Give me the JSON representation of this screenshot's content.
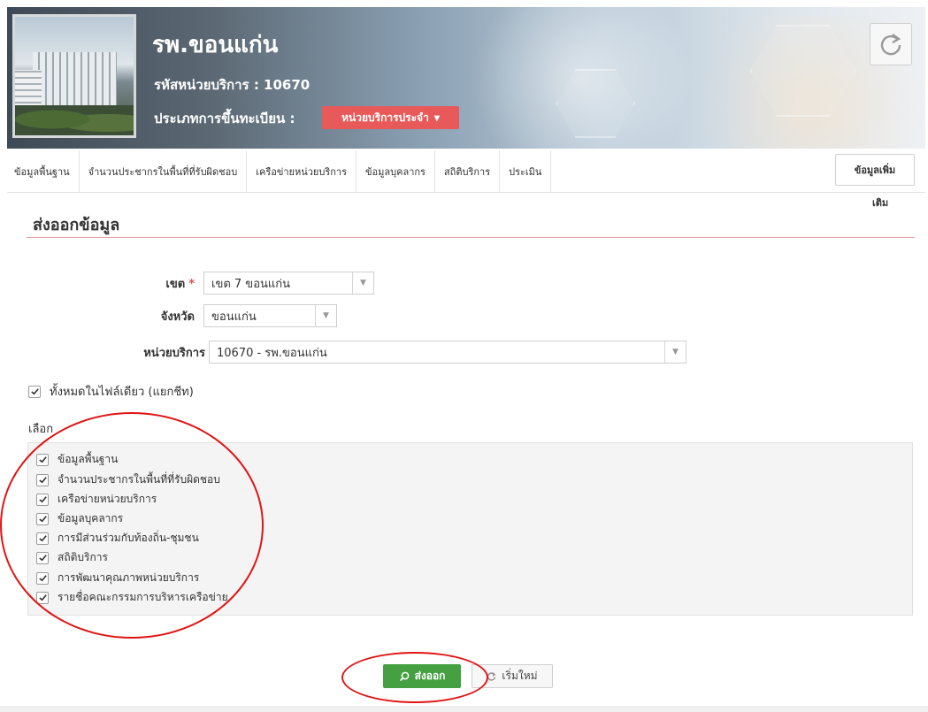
{
  "header": {
    "hospital_name": "รพ.ขอนแก่น",
    "unit_code": "รหัสหน่วยบริการ : 10670",
    "type_label": "ประเภทการขึ้นทะเบียน :",
    "type_value": "หน่วยบริการประจำ",
    "refresh_icon": "refresh-icon"
  },
  "nav": {
    "tabs": [
      "ข้อมูลพื้นฐาน",
      "จำนวนประชากรในพื้นที่ที่รับผิดชอบ",
      "เครือข่ายหน่วยบริการ",
      "ข้อมูลบุคลากร",
      "สถิติบริการ",
      "ประเมิน"
    ],
    "more_line1": "ข้อมูลเพิ่ม",
    "more_line2": "เติม"
  },
  "section": {
    "title": "ส่งออกข้อมูล"
  },
  "form": {
    "zone_label": "เขต",
    "zone_required": "*",
    "zone_value": "เขต 7 ขอนแก่น",
    "province_label": "จังหวัด",
    "province_value": "ขอนแก่น",
    "unit_label": "หน่วยบริการ",
    "unit_value": "10670 - รพ.ขอนแก่น",
    "all_in_one_label": "ทั้งหมดในไฟล์เดียว (แยกชีท)",
    "all_in_one_checked": true,
    "choose_label": "เลือก",
    "options": [
      {
        "label": "ข้อมูลพื้นฐาน",
        "checked": true
      },
      {
        "label": "จำนวนประชากรในพื้นที่ที่รับผิดชอบ",
        "checked": true
      },
      {
        "label": "เครือข่ายหน่วยบริการ",
        "checked": true
      },
      {
        "label": "ข้อมูลบุคลากร",
        "checked": true
      },
      {
        "label": "การมีส่วนร่วมกับท้องถิ่น-ชุมชน",
        "checked": true
      },
      {
        "label": "สถิติบริการ",
        "checked": true
      },
      {
        "label": "การพัฒนาคุณภาพหน่วยบริการ",
        "checked": true
      },
      {
        "label": "รายชื่อคณะกรรมการบริหารเครือข่าย",
        "checked": true
      }
    ]
  },
  "actions": {
    "export_label": "ส่งออก",
    "reset_label": "เริ่มใหม่"
  },
  "colors": {
    "accent_red": "#e8595a",
    "export_green": "#45a041",
    "annotation_red": "#e01414"
  }
}
